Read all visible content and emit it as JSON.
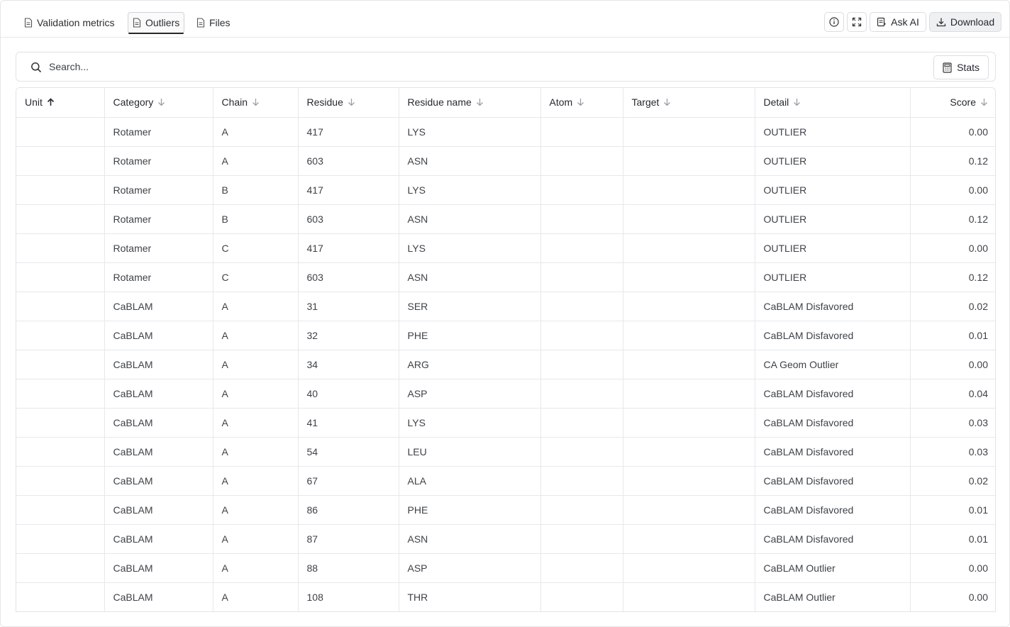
{
  "tabs": [
    {
      "label": "Validation metrics",
      "icon": "document-icon",
      "active": false
    },
    {
      "label": "Outliers",
      "icon": "document-icon",
      "active": true
    },
    {
      "label": "Files",
      "icon": "document-icon",
      "active": false
    }
  ],
  "toolbar": {
    "info_icon": "info-icon",
    "expand_icon": "expand-icon",
    "ask_ai_label": "Ask AI",
    "download_label": "Download"
  },
  "search": {
    "placeholder": "Search...",
    "value": ""
  },
  "stats_label": "Stats",
  "table": {
    "columns": [
      {
        "label": "Unit",
        "sort": "asc"
      },
      {
        "label": "Category",
        "sort": "desc"
      },
      {
        "label": "Chain",
        "sort": "desc"
      },
      {
        "label": "Residue",
        "sort": "desc"
      },
      {
        "label": "Residue name",
        "sort": "desc"
      },
      {
        "label": "Atom",
        "sort": "desc"
      },
      {
        "label": "Target",
        "sort": "desc"
      },
      {
        "label": "Detail",
        "sort": "desc"
      },
      {
        "label": "Score",
        "sort": "desc"
      }
    ],
    "rows": [
      [
        "",
        "Rotamer",
        "A",
        "417",
        "LYS",
        "",
        "",
        "OUTLIER",
        "0.00"
      ],
      [
        "",
        "Rotamer",
        "A",
        "603",
        "ASN",
        "",
        "",
        "OUTLIER",
        "0.12"
      ],
      [
        "",
        "Rotamer",
        "B",
        "417",
        "LYS",
        "",
        "",
        "OUTLIER",
        "0.00"
      ],
      [
        "",
        "Rotamer",
        "B",
        "603",
        "ASN",
        "",
        "",
        "OUTLIER",
        "0.12"
      ],
      [
        "",
        "Rotamer",
        "C",
        "417",
        "LYS",
        "",
        "",
        "OUTLIER",
        "0.00"
      ],
      [
        "",
        "Rotamer",
        "C",
        "603",
        "ASN",
        "",
        "",
        "OUTLIER",
        "0.12"
      ],
      [
        "",
        "CaBLAM",
        "A",
        "31",
        "SER",
        "",
        "",
        "CaBLAM Disfavored",
        "0.02"
      ],
      [
        "",
        "CaBLAM",
        "A",
        "32",
        "PHE",
        "",
        "",
        "CaBLAM Disfavored",
        "0.01"
      ],
      [
        "",
        "CaBLAM",
        "A",
        "34",
        "ARG",
        "",
        "",
        "CA Geom Outlier",
        "0.00"
      ],
      [
        "",
        "CaBLAM",
        "A",
        "40",
        "ASP",
        "",
        "",
        "CaBLAM Disfavored",
        "0.04"
      ],
      [
        "",
        "CaBLAM",
        "A",
        "41",
        "LYS",
        "",
        "",
        "CaBLAM Disfavored",
        "0.03"
      ],
      [
        "",
        "CaBLAM",
        "A",
        "54",
        "LEU",
        "",
        "",
        "CaBLAM Disfavored",
        "0.03"
      ],
      [
        "",
        "CaBLAM",
        "A",
        "67",
        "ALA",
        "",
        "",
        "CaBLAM Disfavored",
        "0.02"
      ],
      [
        "",
        "CaBLAM",
        "A",
        "86",
        "PHE",
        "",
        "",
        "CaBLAM Disfavored",
        "0.01"
      ],
      [
        "",
        "CaBLAM",
        "A",
        "87",
        "ASN",
        "",
        "",
        "CaBLAM Disfavored",
        "0.01"
      ],
      [
        "",
        "CaBLAM",
        "A",
        "88",
        "ASP",
        "",
        "",
        "CaBLAM Outlier",
        "0.00"
      ],
      [
        "",
        "CaBLAM",
        "A",
        "108",
        "THR",
        "",
        "",
        "CaBLAM Outlier",
        "0.00"
      ],
      [
        "",
        "",
        "",
        "",
        "",
        "",
        "",
        "",
        ""
      ]
    ]
  }
}
